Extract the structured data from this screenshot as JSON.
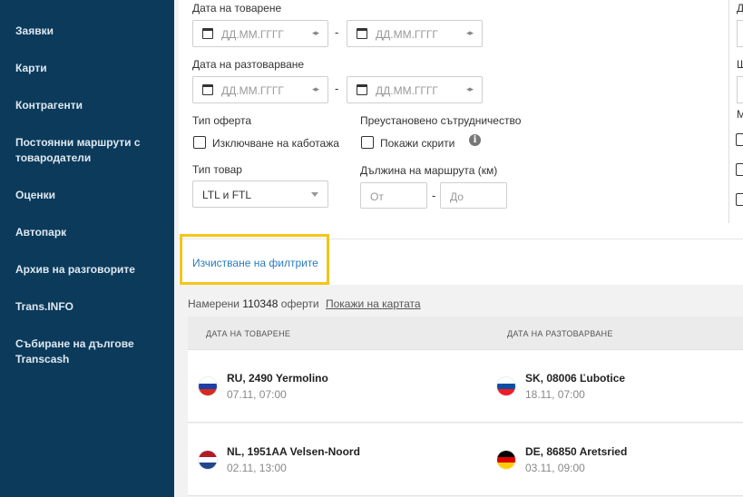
{
  "sidebar": {
    "items": [
      {
        "label": "Заявки"
      },
      {
        "label": "Карти"
      },
      {
        "label": "Контрагенти"
      },
      {
        "label": "Постоянни маршрути с товародатели"
      },
      {
        "label": "Оценки"
      },
      {
        "label": "Автопарк"
      },
      {
        "label": "Архив на разговорите"
      },
      {
        "label": "Trans.INFO"
      },
      {
        "label": "Събиране на дългове Transcash"
      }
    ]
  },
  "filters": {
    "loading_date": {
      "label": "Дата на товарене",
      "from_placeholder": "ДД.ММ.ГГГГ",
      "to_placeholder": "ДД.ММ.ГГГГ",
      "separator": "-"
    },
    "unloading_date": {
      "label": "Дата на разтоварване",
      "from_placeholder": "ДД.ММ.ГГГГ",
      "to_placeholder": "ДД.ММ.ГГГГ",
      "separator": "-"
    },
    "offer_type": {
      "label": "Тип оферта",
      "exclude_cabotage": "Изключване на каботажа"
    },
    "suspended": {
      "label": "Преустановено сътрудничество",
      "show_hidden": "Покажи скрити"
    },
    "goods_type": {
      "label": "Тип товар",
      "value": "LTL и FTL"
    },
    "route_length": {
      "label": "Дължина на маршрута (км)",
      "from_placeholder": "От",
      "to_placeholder": "До",
      "separator": "-"
    },
    "right_fragments": {
      "a": "Д",
      "b": "Ш",
      "c": "М"
    },
    "clear_filters": "Изчистване на филтрите"
  },
  "results": {
    "found_prefix": "Намерени",
    "count": "110348",
    "found_suffix": "оферти",
    "show_on_map": "Покажи на картата",
    "columns": {
      "loading": "ДАТА НА ТОВАРЕНЕ",
      "unloading": "ДАТА НА РАЗТОВАРВАНЕ"
    },
    "rows": [
      {
        "from": {
          "place": "RU, 2490 Yermolino",
          "datetime": "07.11, 07:00",
          "flag": "ru-flag-icon"
        },
        "to": {
          "place": "SK, 08006 Ľubotice",
          "datetime": "18.11, 07:00",
          "flag": "sk-flag-icon"
        }
      },
      {
        "from": {
          "place": "NL, 1951AA Velsen-Noord",
          "datetime": "02.11, 13:00",
          "flag": "nl-flag-icon"
        },
        "to": {
          "place": "DE, 86850 Aretsried",
          "datetime": "03.11, 09:00",
          "flag": "de-flag-icon"
        }
      }
    ]
  },
  "colors": {
    "sidebar": "#0b3a5b",
    "accent_link": "#2a7bc0",
    "highlight": "#f5c518"
  }
}
